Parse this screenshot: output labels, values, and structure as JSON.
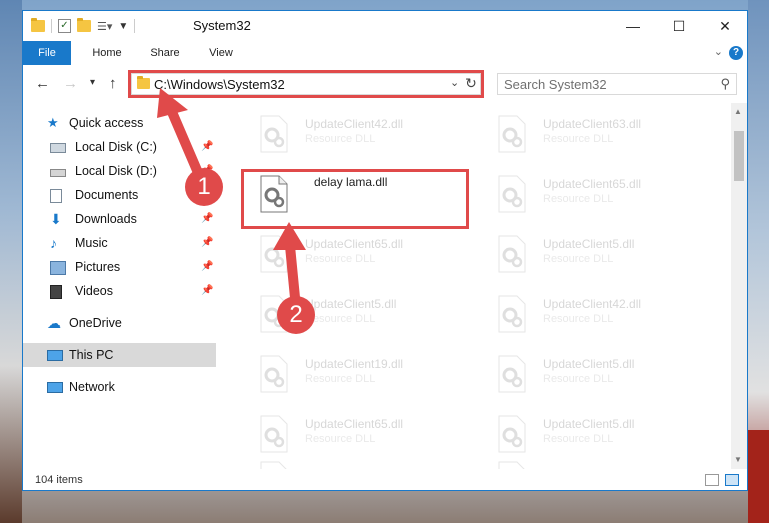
{
  "window": {
    "title": "System32"
  },
  "ribbon": {
    "tabs": [
      "File",
      "Home",
      "Share",
      "View"
    ],
    "help": "?"
  },
  "controls": {
    "minimize": "—",
    "maximize": "☐",
    "close": "✕"
  },
  "address": {
    "path": "C:\\Windows\\System32"
  },
  "search": {
    "placeholder": "Search System32"
  },
  "nav": {
    "quick_access": "Quick access",
    "items": [
      "Local Disk (C:)",
      "Local Disk (D:)",
      "Documents",
      "Downloads",
      "Music",
      "Pictures",
      "Videos"
    ],
    "onedrive": "OneDrive",
    "this_pc": "This PC",
    "network": "Network"
  },
  "files": [
    {
      "name": "UpdateClient42.dll",
      "type": "Resource DLL"
    },
    {
      "name": "UpdateClient63.dll",
      "type": "Resource DLL"
    },
    {
      "name": "delay lama.dll",
      "type": ""
    },
    {
      "name": "UpdateClient65.dll",
      "type": "Resource DLL"
    },
    {
      "name": "UpdateClient65.dll",
      "type": "Resource DLL"
    },
    {
      "name": "UpdateClient5.dll",
      "type": "Resource DLL"
    },
    {
      "name": "UpdateClient5.dll",
      "type": "Resource DLL"
    },
    {
      "name": "UpdateClient42.dll",
      "type": "Resource DLL"
    },
    {
      "name": "UpdateClient19.dll",
      "type": "Resource DLL"
    },
    {
      "name": "UpdateClient5.dll",
      "type": "Resource DLL"
    },
    {
      "name": "UpdateClient65.dll",
      "type": "Resource DLL"
    },
    {
      "name": "UpdateClient5.dll",
      "type": "Resource DLL"
    },
    {
      "name": "",
      "type": ""
    },
    {
      "name": "",
      "type": ""
    }
  ],
  "status": {
    "count": "104 items"
  },
  "callouts": [
    "1",
    "2"
  ],
  "colors": {
    "accent": "#1979ca",
    "highlight": "#e04a4a"
  }
}
